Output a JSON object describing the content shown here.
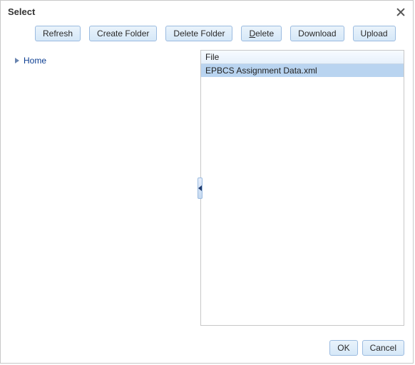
{
  "title": "Select",
  "toolbar": {
    "refresh": "Refresh",
    "create_folder": "Create Folder",
    "delete_folder": "Delete Folder",
    "delete_prefix": "D",
    "delete_rest": "elete",
    "download": "Download",
    "upload": "Upload"
  },
  "tree": {
    "root": "Home"
  },
  "filepanel": {
    "header": "File",
    "rows": [
      "EPBCS Assignment Data.xml"
    ]
  },
  "footer": {
    "ok": "OK",
    "cancel": "Cancel"
  }
}
